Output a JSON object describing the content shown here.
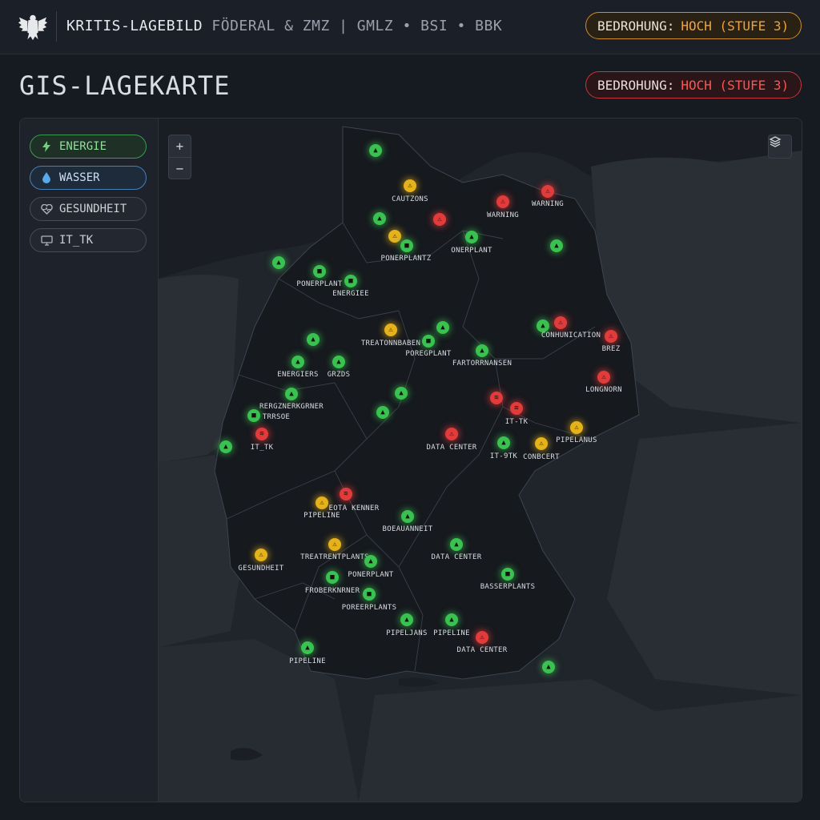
{
  "header": {
    "title_main": "KRITIS-LAGEBILD",
    "title_sub": "FÖDERAL & ZMZ | GMLZ • BSI • BBK",
    "threat_label": "BEDROHUNG:",
    "threat_value": "HOCH (STUFE 3)",
    "threat_color": "#f0a33a"
  },
  "page": {
    "title": "GIS-LAGEKARTE",
    "threat_label": "BEDROHUNG:",
    "threat_value": "HOCH (STUFE 3)",
    "threat_color": "#ff5353"
  },
  "layers": [
    {
      "label": "ENERGIE",
      "icon": "lightning-icon"
    },
    {
      "label": "WASSER",
      "icon": "water-drop-icon"
    },
    {
      "label": "GESUNDHEIT",
      "icon": "heart-pulse-icon"
    },
    {
      "label": "IT_TK",
      "icon": "monitor-icon"
    }
  ],
  "map_controls": {
    "zoom_in": "+",
    "zoom_out": "−",
    "layers_icon": "layers-icon"
  },
  "status_colors": {
    "ok": "#39c24f",
    "warning": "#e5b21c",
    "critical": "#e23b3b"
  },
  "labels": {
    "l1": "CAUTZONS",
    "l2": "WARNING",
    "l3": "WARNING",
    "l4": "PONERPLANTZ",
    "l5": "ONERPLANT",
    "l6": "PONERPLANT",
    "l7": "ENERGIEE",
    "l8": "TREATONNBABEN",
    "l9": "POREGPLANT",
    "l10": "CONHUNICATION",
    "l11": "BREZ",
    "l12": "FARTORRNANSEN",
    "l13": "ENERGIERS",
    "l14": "GRZDS",
    "l15": "LONGNORN",
    "l16": "RERGZNERKGRNER",
    "l17": "TRRSOE",
    "l18": "IT_TK",
    "l19": "IT-TK",
    "l20": "DATA CENTER",
    "l21": "IT-9TK",
    "l22": "CONBCERT",
    "l23": "PIPELANUS",
    "l24": "EOTA KENNER",
    "l25": "PIPELINE",
    "l26": "BOEAUANNEIT",
    "l27": "DATA CENTER",
    "l28": "TREATRENTPLANTS",
    "l29": "GESUNDHEIT",
    "l30": "PONERPLANT",
    "l31": "FROBERKNRNER",
    "l32": "BASSERPLANTS",
    "l33": "POREERPLANTS",
    "l34": "PIPELJANS",
    "l35": "PIPELINE",
    "l36": "DATA CENTER",
    "l37": "PIPELINE"
  }
}
